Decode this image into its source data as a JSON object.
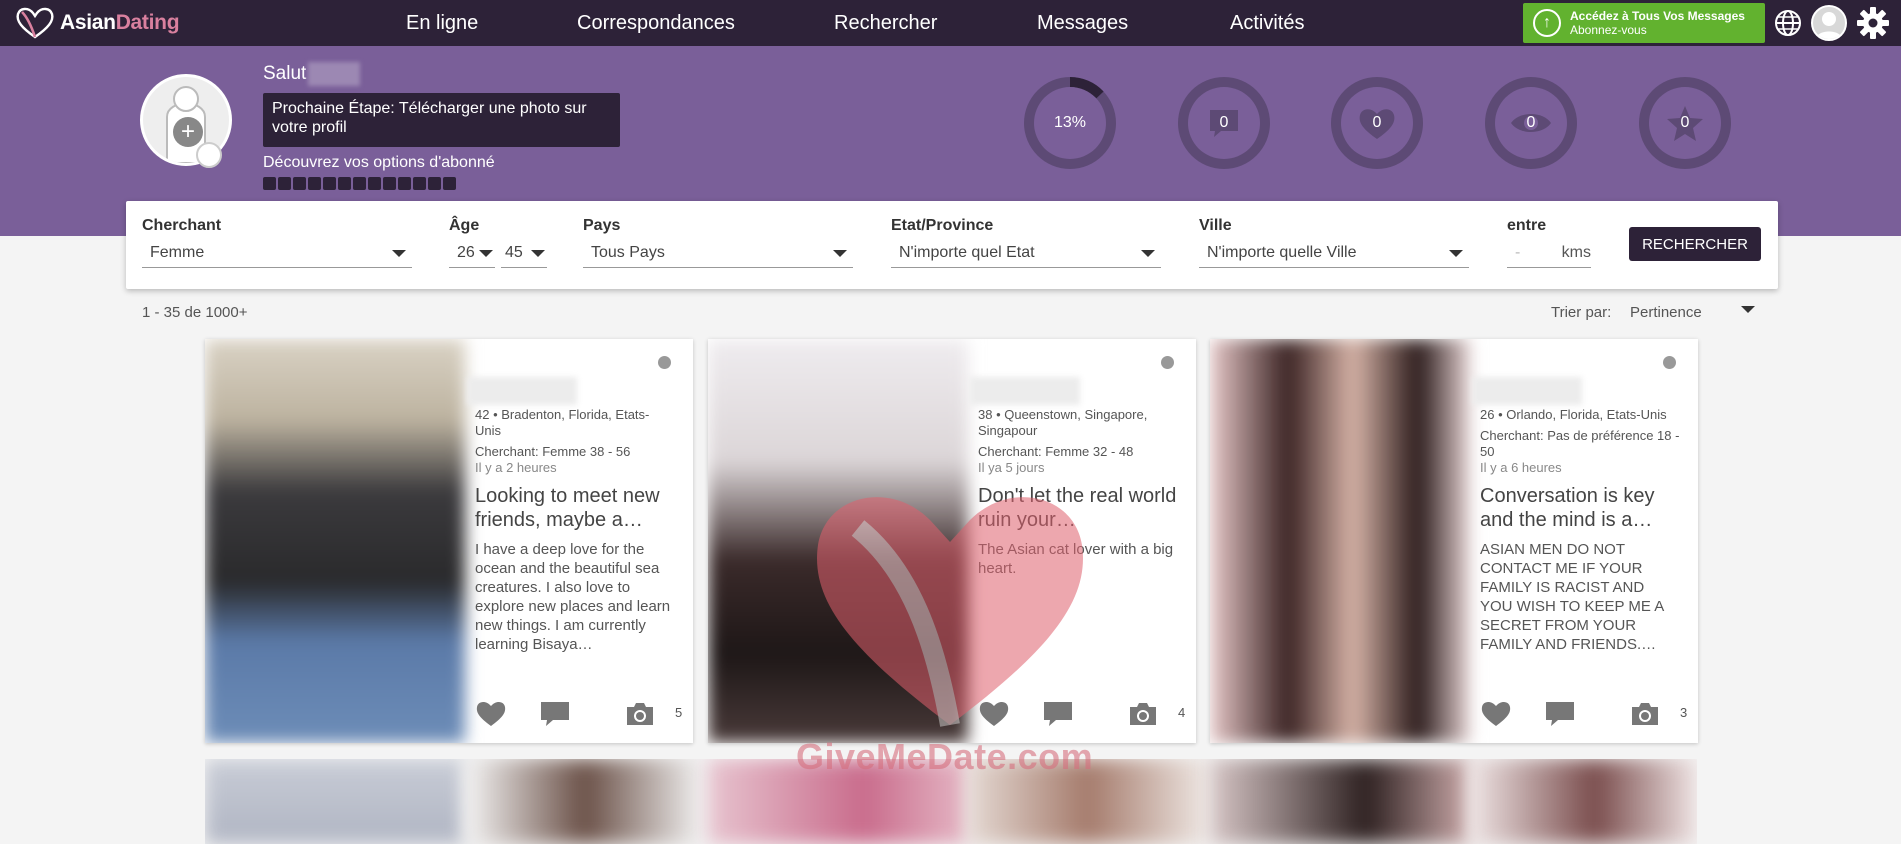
{
  "nav": {
    "brand_a": "Asian",
    "brand_b": "Dating",
    "links": [
      "En ligne",
      "Correspondances",
      "Rechercher",
      "Messages",
      "Activités"
    ],
    "upgrade_line1": "Accédez à Tous Vos Messages",
    "upgrade_line2": "Abonnez-vous"
  },
  "header": {
    "greeting": "Salut",
    "next_step": "Prochaine Étape: Télécharger une photo sur votre profil",
    "discover": "Découvrez vos options d'abonné",
    "stats": [
      {
        "value": "13%",
        "icon": "progress-ring"
      },
      {
        "value": "0",
        "icon": "chat-bubble-icon"
      },
      {
        "value": "0",
        "icon": "heart-icon"
      },
      {
        "value": "0",
        "icon": "eye-icon"
      },
      {
        "value": "0",
        "icon": "star-icon"
      }
    ],
    "profile_completion": 0.13
  },
  "search": {
    "seeking_label": "Cherchant",
    "seeking_value": "Femme",
    "age_label": "Âge",
    "age_min": "26",
    "age_max": "45",
    "country_label": "Pays",
    "country_value": "Tous Pays",
    "state_label": "Etat/Province",
    "state_value": "N'importe quel Etat",
    "city_label": "Ville",
    "city_value": "N'importe quelle Ville",
    "distance_label": "entre",
    "distance_value": "-",
    "distance_unit": "kms",
    "button": "RECHERCHER"
  },
  "results": {
    "count": "1 - 35 de 1000+",
    "sort_label": "Trier par:",
    "sort_value": "Pertinence"
  },
  "cards": [
    {
      "location": "42 • Bradenton, Florida, Etats-Unis",
      "seeking": "Cherchant: Femme 38 - 56",
      "ago": "Il y a 2 heures",
      "headline": "Looking to meet new friends, maybe a…",
      "desc": "I have a deep love for the ocean and the beautiful sea creatures. I also love to explore new places and learn new things. I am currently learning Bisaya…",
      "photos": "5"
    },
    {
      "location": "38 • Queenstown, Singapore, Singapour",
      "seeking": "Cherchant: Femme 32 - 48",
      "ago": "Il ya 5 jours",
      "headline": "Don't let the real world ruin your…",
      "desc": "The Asian cat lover with a big heart.",
      "photos": "4"
    },
    {
      "location": "26 • Orlando, Florida, Etats-Unis",
      "seeking": "Cherchant: Pas de préférence 18 - 50",
      "ago": "Il y a 6 heures",
      "headline": "Conversation is key and the mind is a…",
      "desc": "ASIAN MEN DO NOT CONTACT ME IF YOUR FAMILY IS RACIST AND YOU WISH TO KEEP ME A SECRET FROM YOUR FAMILY AND FRIENDS.…",
      "photos": "3"
    }
  ],
  "watermark": "GiveMeDate.com"
}
